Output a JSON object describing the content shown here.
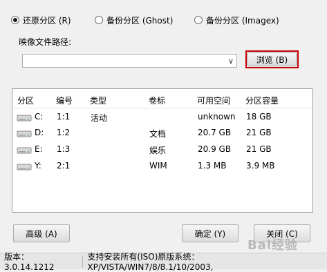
{
  "modes": [
    {
      "label": "还原分区 (R)",
      "selected": true
    },
    {
      "label": "备份分区 (Ghost)",
      "selected": false
    },
    {
      "label": "备份分区 (Imagex)",
      "selected": false
    }
  ],
  "path": {
    "label": "映像文件路径:",
    "value": "",
    "browse_label": "浏览 (B)"
  },
  "table": {
    "headers": [
      "分区",
      "编号",
      "类型",
      "卷标",
      "可用空间",
      "分区容量"
    ],
    "rows": [
      {
        "drive": "C:",
        "num": "1:1",
        "type": "活动",
        "label": "",
        "free": "unknown",
        "size": "18 GB"
      },
      {
        "drive": "D:",
        "num": "1:2",
        "type": "",
        "label": "文档",
        "free": "20.7 GB",
        "size": "21 GB"
      },
      {
        "drive": "E:",
        "num": "1:3",
        "type": "",
        "label": "娱乐",
        "free": "20.9 GB",
        "size": "21 GB"
      },
      {
        "drive": "Y:",
        "num": "2:1",
        "type": "",
        "label": "WIM",
        "free": "1.3 MB",
        "size": "3.9 MB"
      }
    ]
  },
  "buttons": {
    "advanced": "高级 (A)",
    "ok": "确定 (Y)",
    "close": "关闭 (C)"
  },
  "status": {
    "version": "版本：3.0.14.1212",
    "support": "支持安装所有(ISO)原版系统：XP/VISTA/WIN7/8/8.1/10/2003,"
  },
  "watermark": "Bai经验"
}
